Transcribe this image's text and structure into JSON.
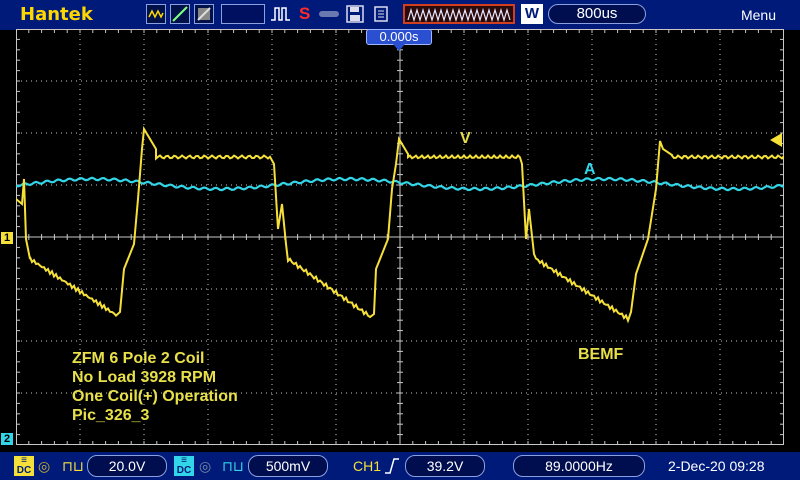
{
  "header": {
    "brand": "Hantek",
    "run_state": "S",
    "timebase": "800us",
    "menu_label": "Menu",
    "trigger_mode": "W"
  },
  "screen": {
    "time_offset": "0.000s",
    "trace_labels": {
      "voltage": "V",
      "current": "A",
      "bemf": "BEMF"
    },
    "annotation_lines": [
      "ZFM 6 Pole 2 Coil",
      "No Load 3928 RPM",
      "One Coil(+) Operation",
      "Pic_326_3"
    ],
    "channel_markers": {
      "ch1": "1",
      "ch2": "2"
    }
  },
  "footer": {
    "ch1_coupling": "DC",
    "ch1_scale": "20.0V",
    "ch2_coupling": "DC",
    "ch2_scale": "500mV",
    "trigger_source": "CH1",
    "trigger_level": "39.2V",
    "frequency": "89.0000Hz",
    "datetime": "2-Dec-20 09:28"
  },
  "colors": {
    "ch1": "#f5e03a",
    "ch2": "#33d6e8",
    "bar_bg": "#001a7a",
    "grid": "#c8c8c8"
  }
}
